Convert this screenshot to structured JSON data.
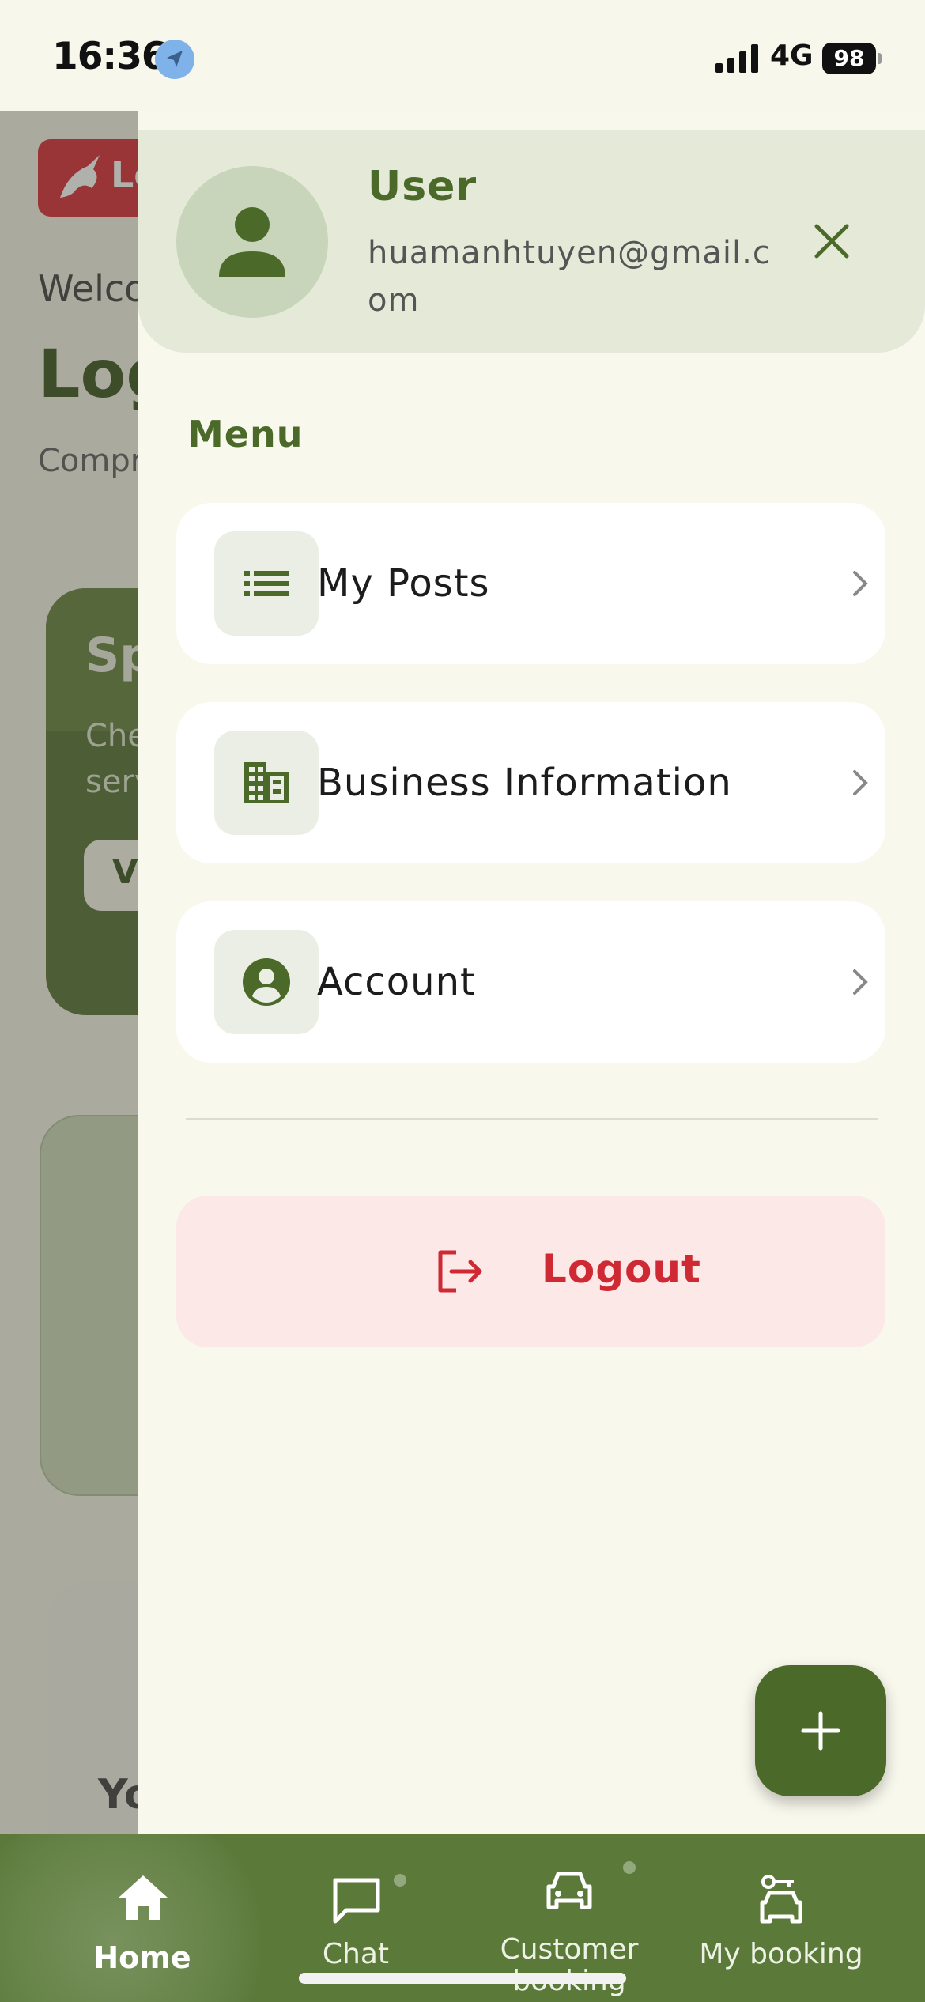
{
  "status_bar": {
    "time": "16:36",
    "network": "4G",
    "battery": "98"
  },
  "background_page": {
    "logo_text": "Lo",
    "welcome": "Welco",
    "heading": "Log",
    "subtitle": "Compr",
    "card_title": "Sp",
    "card_text_line1": "Che",
    "card_text_line2": "serv",
    "card_button": "Vi",
    "card3_text": "Yo"
  },
  "drawer": {
    "user_name": "User",
    "user_email": "huamanhtuyen@gmail.com",
    "menu_title": "Menu",
    "items": [
      {
        "label": "My Posts",
        "icon": "list-icon"
      },
      {
        "label": "Business Information",
        "icon": "building-icon"
      },
      {
        "label": "Account",
        "icon": "account-circle-icon"
      }
    ],
    "logout_label": "Logout"
  },
  "bottom_nav": {
    "items": [
      {
        "label": "Home",
        "icon": "home-icon",
        "active": true
      },
      {
        "label": "Chat",
        "icon": "chat-icon",
        "active": false
      },
      {
        "label": "Customer booking",
        "icon": "car-icon",
        "active": false
      },
      {
        "label": "My booking",
        "icon": "car-key-icon",
        "active": false
      }
    ]
  },
  "colors": {
    "primary": "#4b6a29",
    "nav_background": "#5b7a3a",
    "drawer_background": "#f8f8ed",
    "logout_text": "#cf2a33",
    "logout_background": "#fde8e8"
  }
}
